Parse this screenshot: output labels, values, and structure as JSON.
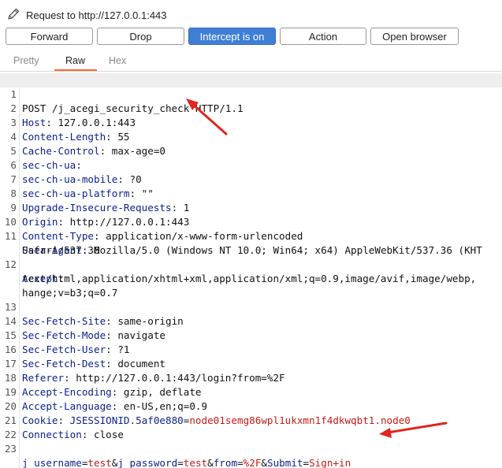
{
  "window": {
    "title": "Request to http://127.0.0.1:443",
    "title_icon": "pencil-icon"
  },
  "toolbar": {
    "forward": "Forward",
    "drop": "Drop",
    "intercept": "Intercept is on",
    "action": "Action",
    "open_browser": "Open browser",
    "active_color": "#3f7fd5"
  },
  "tabs": {
    "pretty": "Pretty",
    "raw": "Raw",
    "hex": "Hex",
    "selected": "Raw",
    "underline_color": "#ff6633"
  },
  "request": {
    "line_numbers": [
      "1",
      "2",
      "3",
      "4",
      "5",
      "6",
      "7",
      "8",
      "9",
      "10",
      "11",
      "12",
      "13",
      "14",
      "15",
      "16",
      "17",
      "18",
      "19",
      "20",
      "21",
      "22",
      "23"
    ],
    "request_line": "POST /j_acegi_security_check HTTP/1.1",
    "headers": [
      {
        "name": "Host",
        "value": " 127.0.0.1:443"
      },
      {
        "name": "Content-Length",
        "value": " 55"
      },
      {
        "name": "Cache-Control",
        "value": " max-age=0"
      },
      {
        "name": "sec-ch-ua",
        "value": ""
      },
      {
        "name": "sec-ch-ua-mobile",
        "value": " ?0"
      },
      {
        "name": "sec-ch-ua-platform",
        "value": " \"\""
      },
      {
        "name": "Upgrade-Insecure-Requests",
        "value": " 1"
      },
      {
        "name": "Origin",
        "value": " http://127.0.0.1:443"
      },
      {
        "name": "Content-Type",
        "value": " application/x-www-form-urlencoded"
      },
      {
        "name": "User-Agent",
        "value": " Mozilla/5.0 (Windows NT 10.0; Win64; x64) AppleWebKit/537.36 (KHT",
        "cont": "Safari/537.36"
      },
      {
        "name": "Accept",
        "value": "",
        "cont": "text/html,application/xhtml+xml,application/xml;q=0.9,image/avif,image/webp,",
        "cont2": "hange;v=b3;q=0.7"
      },
      {
        "name": "Sec-Fetch-Site",
        "value": " same-origin"
      },
      {
        "name": "Sec-Fetch-Mode",
        "value": " navigate"
      },
      {
        "name": "Sec-Fetch-User",
        "value": " ?1"
      },
      {
        "name": "Sec-Fetch-Dest",
        "value": " document"
      },
      {
        "name": "Referer",
        "value": " http://127.0.0.1:443/login?from=%2F"
      },
      {
        "name": "Accept-Encoding",
        "value": " gzip, deflate"
      },
      {
        "name": "Accept-Language",
        "value": " en-US,en;q=0.9"
      },
      {
        "name": "Cookie",
        "cookie_name": " JSESSIONID.5af0e880",
        "cookie_eq": "=",
        "cookie_value": "node01semg86wpl1ukxmn1f4dkwqbt1.node0"
      },
      {
        "name": "Connection",
        "value": " close"
      }
    ],
    "body": [
      {
        "name": "j_username",
        "eq": "=",
        "value": "test",
        "amp": "&"
      },
      {
        "name": "j_password",
        "eq": "=",
        "value": "test",
        "amp": "&"
      },
      {
        "name": "from",
        "eq": "=",
        "value": "%2F",
        "amp": "&"
      },
      {
        "name": "Submit",
        "eq": "=",
        "value": "Sign+in",
        "amp": ""
      }
    ],
    "colors": {
      "header_name": "#0a1f8c",
      "param_value": "#c41a16",
      "annotation_arrow": "#e0261f"
    }
  }
}
